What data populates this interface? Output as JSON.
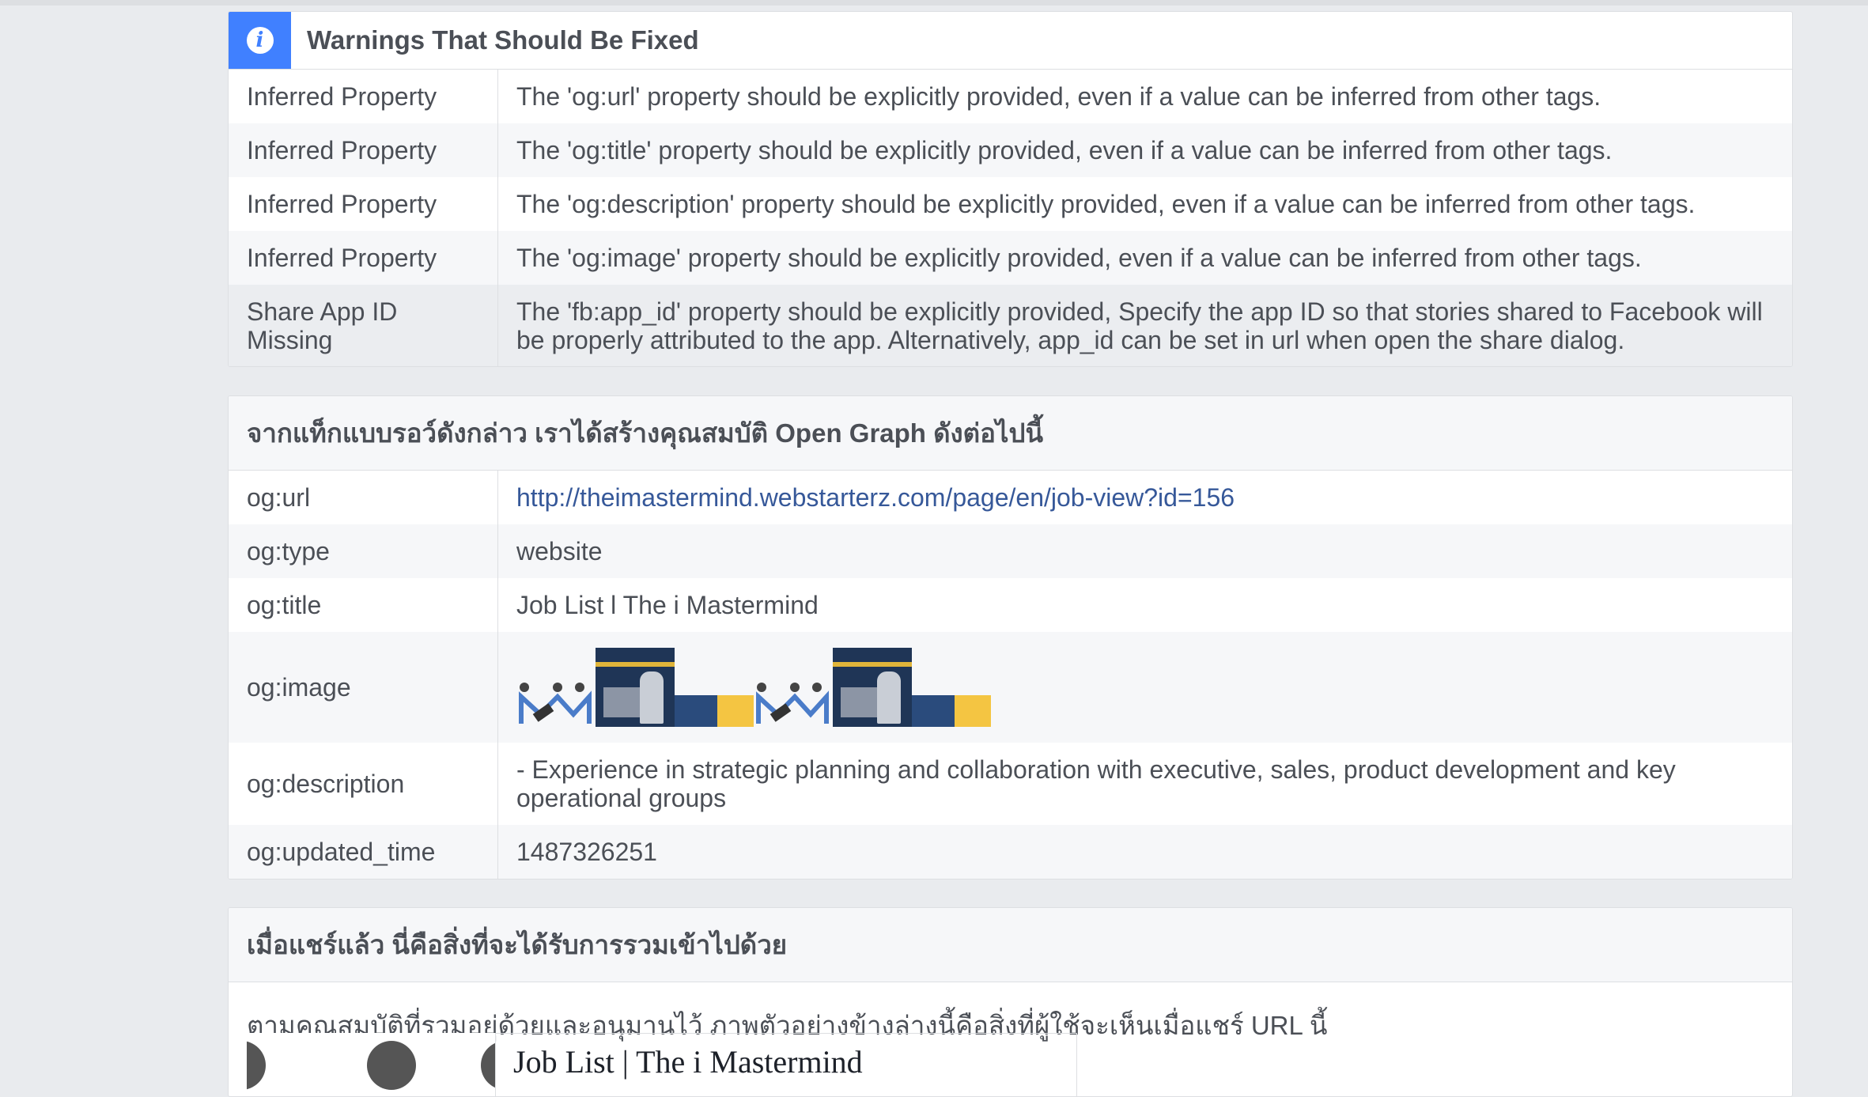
{
  "warnings": {
    "title": "Warnings That Should Be Fixed",
    "icon": "info-icon",
    "rows": [
      {
        "label": "Inferred Property",
        "message": "The 'og:url' property should be explicitly provided, even if a value can be inferred from other tags."
      },
      {
        "label": "Inferred Property",
        "message": "The 'og:title' property should be explicitly provided, even if a value can be inferred from other tags."
      },
      {
        "label": "Inferred Property",
        "message": "The 'og:description' property should be explicitly provided, even if a value can be inferred from other tags."
      },
      {
        "label": "Inferred Property",
        "message": "The 'og:image' property should be explicitly provided, even if a value can be inferred from other tags."
      },
      {
        "label": "Share App ID Missing",
        "message": "The 'fb:app_id' property should be explicitly provided, Specify the app ID so that stories shared to Facebook will be properly attributed to the app. Alternatively, app_id can be set in url when open the share dialog."
      }
    ]
  },
  "og": {
    "heading": "จากแท็กแบบรอว์ดังกล่าว เราได้สร้างคุณสมบัติ Open Graph ดังต่อไปนี้",
    "url_key": "og:url",
    "url_value": "http://theimastermind.webstarterz.com/page/en/job-view?id=156",
    "type_key": "og:type",
    "type_value": "website",
    "title_key": "og:title",
    "title_value": "Job List l The i Mastermind",
    "image_key": "og:image",
    "description_key": "og:description",
    "description_value": "- Experience in strategic planning and collaboration with executive, sales, product development and key operational groups",
    "updated_key": "og:updated_time",
    "updated_value": "1487326251"
  },
  "share": {
    "heading": "เมื่อแชร์แล้ว นี่คือสิ่งที่จะได้รับการรวมเข้าไปด้วย",
    "description": "ตามคุณสมบัติที่รวมอยู่ด้วยและอนุมานไว้ ภาพตัวอย่างข้างล่างนี้คือสิ่งที่ผู้ใช้จะเห็นเมื่อแชร์ URL นี้",
    "preview_title": "Job List | The i Mastermind"
  },
  "colors": {
    "page_bg": "#e9ebee",
    "accent": "#4080ff",
    "link": "#365899",
    "text": "#4b4f56"
  }
}
